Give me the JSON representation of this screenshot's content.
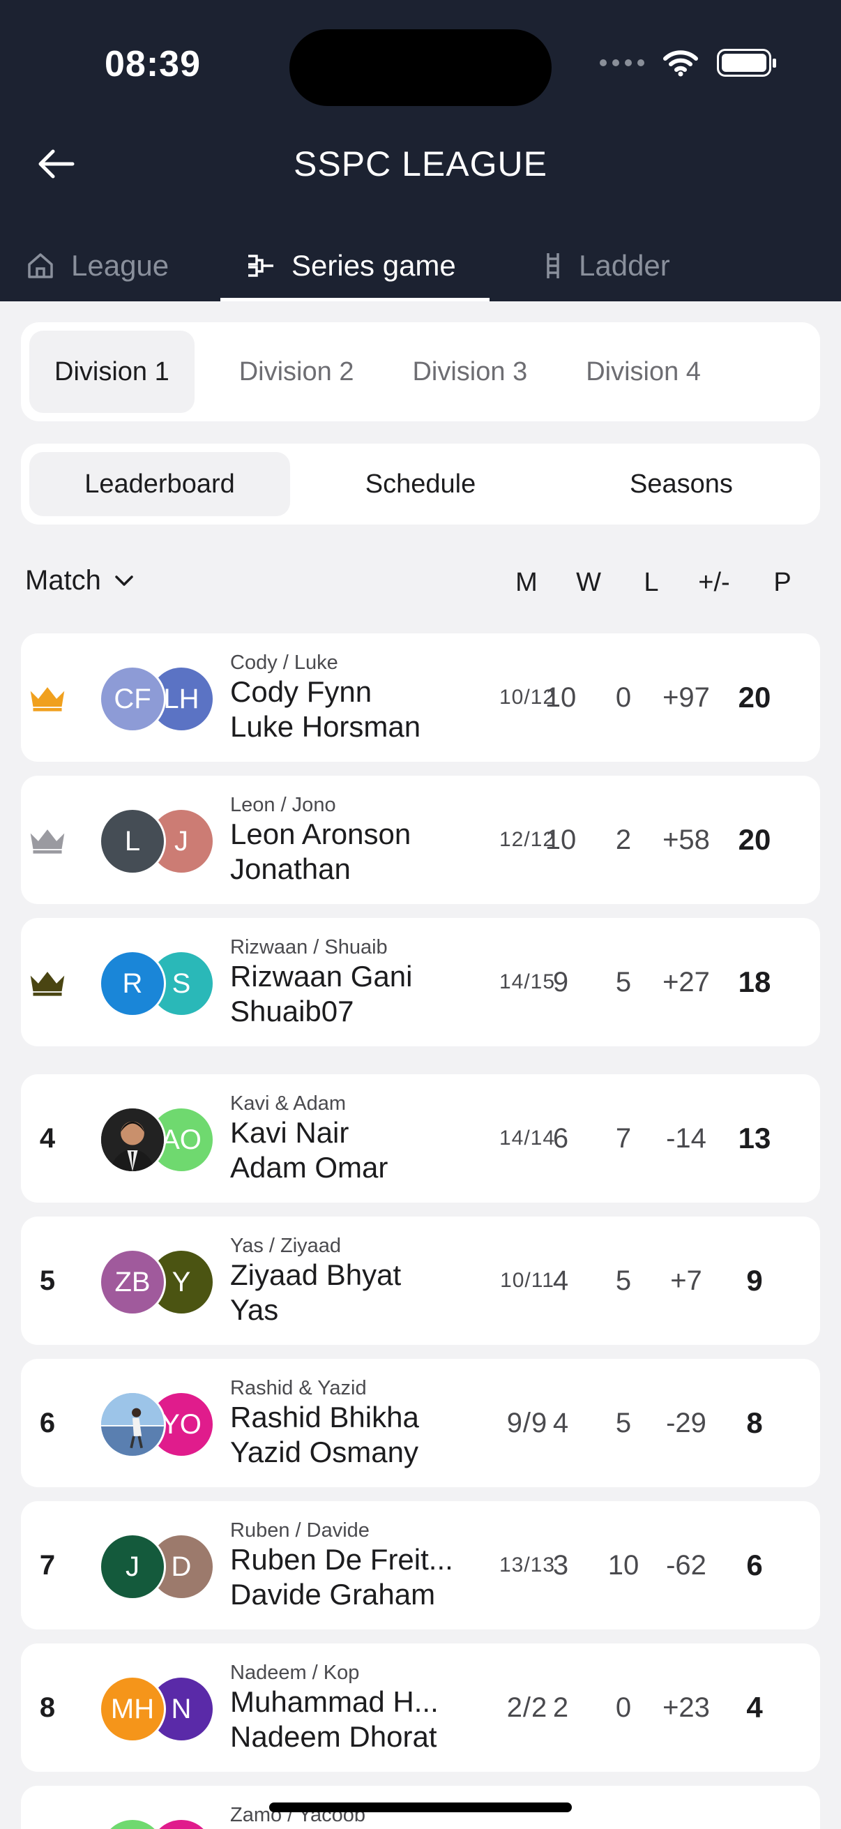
{
  "status_bar": {
    "time": "08:39"
  },
  "header": {
    "title": "SSPC LEAGUE"
  },
  "main_tabs": [
    {
      "label": "League",
      "icon": "home-icon"
    },
    {
      "label": "Series game",
      "icon": "bracket-icon"
    },
    {
      "label": "Ladder",
      "icon": "ladder-icon"
    }
  ],
  "division_tabs": [
    "Division 1",
    "Division 2",
    "Division 3",
    "Division 4"
  ],
  "sub_tabs": [
    "Leaderboard",
    "Schedule",
    "Seasons"
  ],
  "filter": {
    "label": "Match"
  },
  "columns": [
    "M",
    "W",
    "L",
    "+/-",
    "P"
  ],
  "crown_colors": {
    "gold": "#f0a01e",
    "silver": "#9a9aa0",
    "bronze": "#4a4512"
  },
  "rows": [
    {
      "rank": "",
      "crown": "gold",
      "team": "Cody / Luke",
      "p1": "Cody Fynn",
      "p2": "Luke Horsman",
      "a1": "CF",
      "a1c": "#8d9bd6",
      "a2": "LH",
      "a2c": "#5b73c4",
      "m": "10/12",
      "w": "10",
      "l": "0",
      "diff": "+97",
      "p": "20"
    },
    {
      "rank": "",
      "crown": "silver",
      "team": "Leon / Jono",
      "p1": "Leon Aronson",
      "p2": "Jonathan",
      "a1": "L",
      "a1c": "#454d55",
      "a2": "J",
      "a2c": "#cc7c74",
      "m": "12/12",
      "w": "10",
      "l": "2",
      "diff": "+58",
      "p": "20"
    },
    {
      "rank": "",
      "crown": "bronze",
      "team": "Rizwaan / Shuaib",
      "p1": "Rizwaan Gani",
      "p2": "Shuaib07",
      "a1": "R",
      "a1c": "#1a86d8",
      "a2": "S",
      "a2c": "#2ab8b8",
      "m": "14/15",
      "w": "9",
      "l": "5",
      "diff": "+27",
      "p": "18"
    },
    {
      "rank": "4",
      "crown": "",
      "team": "Kavi & Adam",
      "p1": "Kavi Nair",
      "p2": "Adam Omar",
      "a1": "",
      "a1c": "#2a2a2a",
      "a2": "AO",
      "a2c": "#6fd96f",
      "m": "14/14",
      "w": "6",
      "l": "7",
      "diff": "-14",
      "p": "13"
    },
    {
      "rank": "5",
      "crown": "",
      "team": "Yas / Ziyaad",
      "p1": "Ziyaad Bhyat",
      "p2": "Yas",
      "a1": "ZB",
      "a1c": "#a05a9c",
      "a2": "Y",
      "a2c": "#4b5412",
      "m": "10/11",
      "w": "4",
      "l": "5",
      "diff": "+7",
      "p": "9"
    },
    {
      "rank": "6",
      "crown": "",
      "team": "Rashid & Yazid",
      "p1": "Rashid Bhikha",
      "p2": "Yazid Osmany",
      "a1": "",
      "a1c": "#8ab4de",
      "a2": "YO",
      "a2c": "#e01c8c",
      "m": "9/9",
      "w": "4",
      "l": "5",
      "diff": "-29",
      "p": "8"
    },
    {
      "rank": "7",
      "crown": "",
      "team": "Ruben / Davide",
      "p1": "Ruben De Freit...",
      "p2": "Davide Graham",
      "a1": "J",
      "a1c": "#145a3c",
      "a2": "D",
      "a2c": "#9c7a6c",
      "m": "13/13",
      "w": "3",
      "l": "10",
      "diff": "-62",
      "p": "6"
    },
    {
      "rank": "8",
      "crown": "",
      "team": "Nadeem / Kop",
      "p1": "Muhammad H...",
      "p2": "Nadeem Dhorat",
      "a1": "MH",
      "a1c": "#f5951a",
      "a2": "N",
      "a2c": "#5a2aa8",
      "m": "2/2",
      "w": "2",
      "l": "0",
      "diff": "+23",
      "p": "4"
    },
    {
      "rank": "",
      "crown": "",
      "team": "Zamo / Yacoob",
      "p1": "",
      "p2": "",
      "a1": "",
      "a1c": "#6fd96f",
      "a2": "",
      "a2c": "#e01c8c",
      "m": "",
      "w": "",
      "l": "",
      "diff": "",
      "p": ""
    }
  ]
}
